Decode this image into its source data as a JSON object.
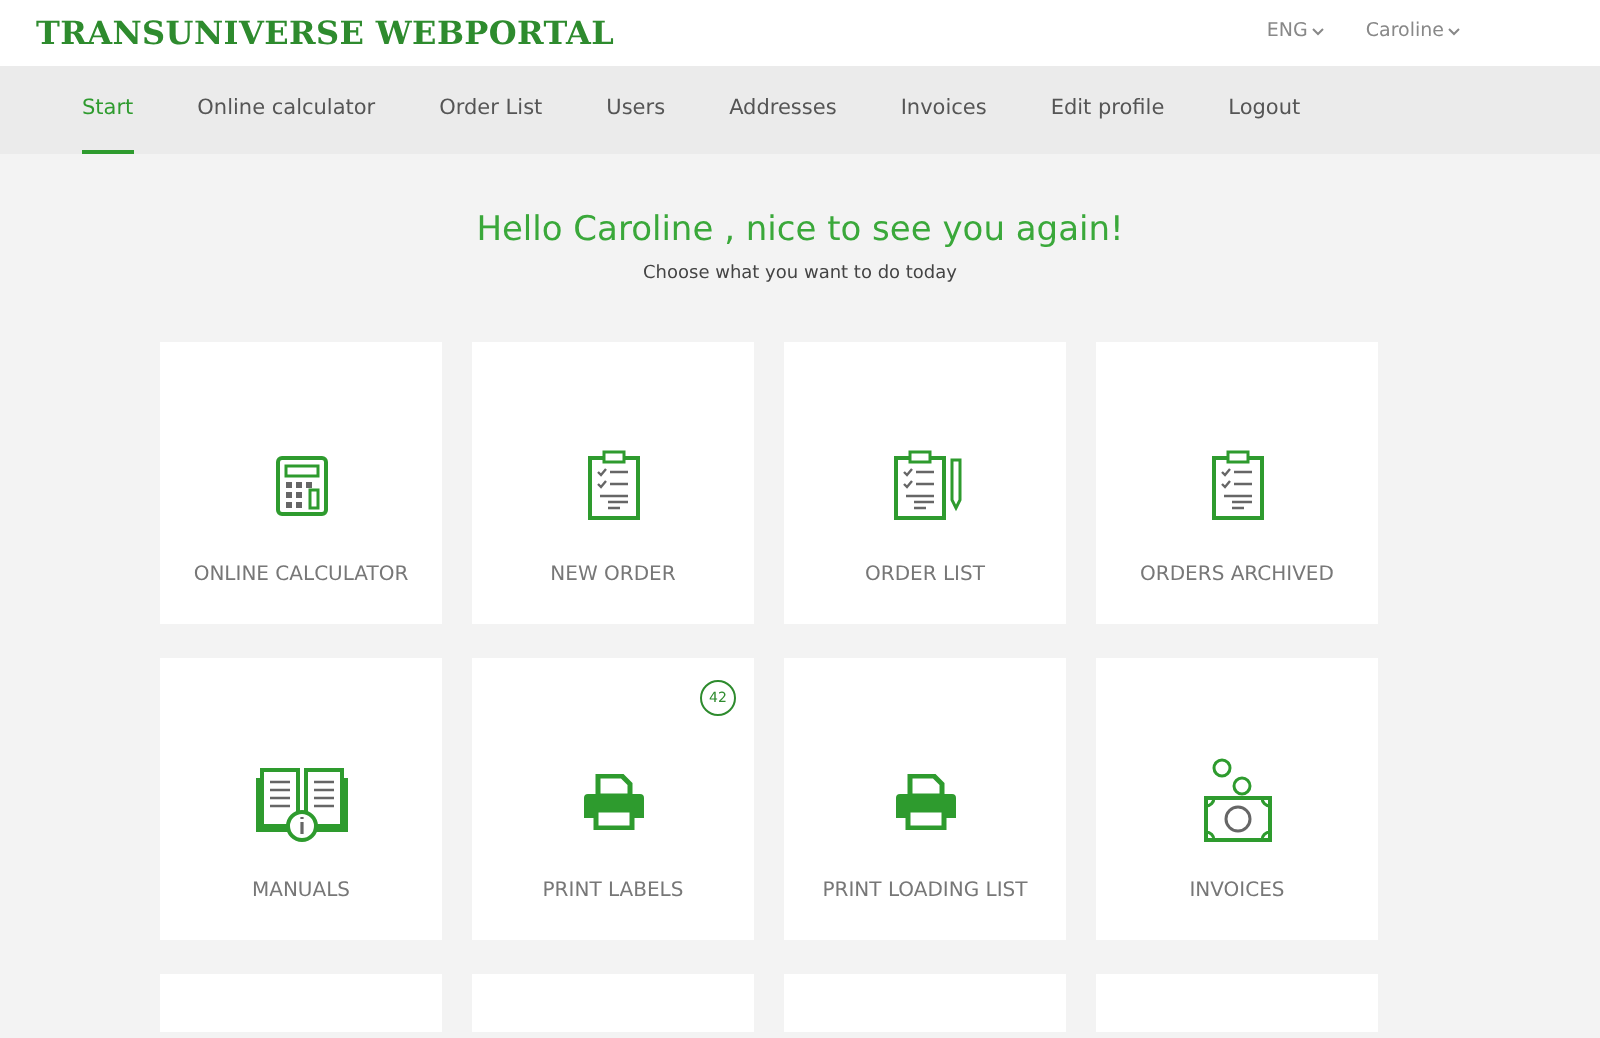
{
  "brand": "TRANSUNIVERSE WEBPORTAL",
  "header_menus": [
    {
      "label": "ENG"
    },
    {
      "label": "Caroline"
    }
  ],
  "nav": [
    {
      "label": "Start",
      "selected": true
    },
    {
      "label": "Online calculator",
      "selected": false
    },
    {
      "label": "Order List",
      "selected": false
    },
    {
      "label": "Users",
      "selected": false
    },
    {
      "label": "Addresses",
      "selected": false
    },
    {
      "label": "Invoices",
      "selected": false
    },
    {
      "label": "Edit profile",
      "selected": false
    },
    {
      "label": "Logout",
      "selected": false
    }
  ],
  "greeting": "Hello Caroline , nice to see you again!",
  "subtitle": "Choose what you want to do today",
  "tiles": [
    {
      "kind": "calculator",
      "label": "ONLINE CALCULATOR"
    },
    {
      "kind": "clipboard",
      "label": "NEW ORDER"
    },
    {
      "kind": "clipboard-pencil",
      "label": "ORDER LIST"
    },
    {
      "kind": "clipboard",
      "label": "ORDERS ARCHIVED"
    },
    {
      "kind": "book",
      "label": "MANUALS"
    },
    {
      "kind": "printer",
      "label": "PRINT LABELS",
      "badge": "42"
    },
    {
      "kind": "printer",
      "label": "PRINT LOADING LIST"
    },
    {
      "kind": "money",
      "label": "INVOICES"
    },
    {
      "kind": "blank"
    },
    {
      "kind": "blank"
    },
    {
      "kind": "blank"
    },
    {
      "kind": "blank"
    }
  ]
}
